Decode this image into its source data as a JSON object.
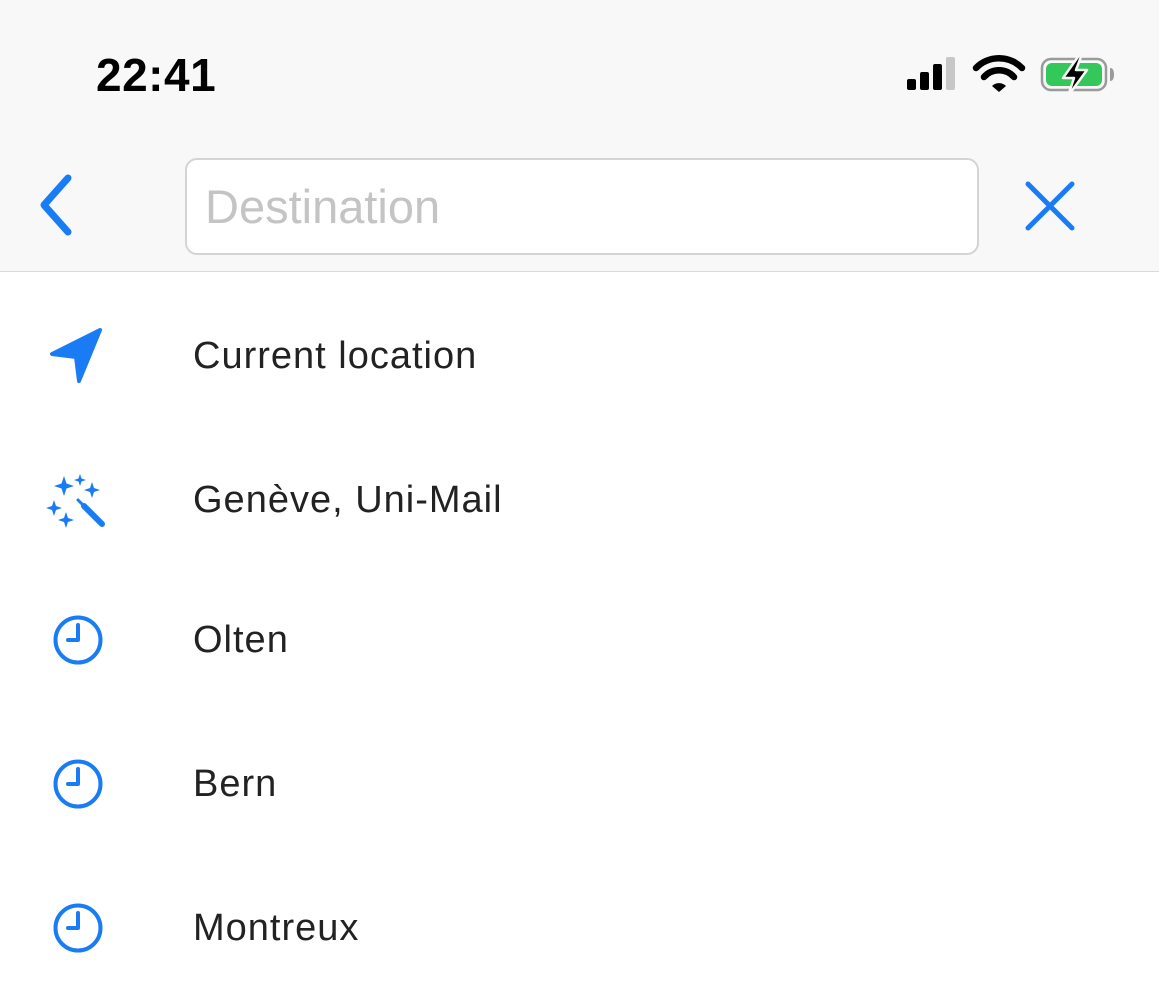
{
  "status_bar": {
    "time": "22:41",
    "icons": [
      "cellular-signal-icon",
      "wifi-icon",
      "battery-charging-icon"
    ]
  },
  "nav": {
    "back_icon": "chevron-left-icon",
    "search_placeholder": "Destination",
    "search_value": "",
    "clear_icon": "close-icon"
  },
  "colors": {
    "accent": "#1a7cf5",
    "battery_fill": "#34c759",
    "text": "#222222",
    "placeholder": "#c4c4c4"
  },
  "list": {
    "items": [
      {
        "label": "Current location",
        "icon": "location-arrow-icon"
      },
      {
        "label": "Genève, Uni-Mail",
        "icon": "magic-wand-icon"
      },
      {
        "label": "Olten",
        "icon": "clock-icon"
      },
      {
        "label": "Bern",
        "icon": "clock-icon"
      },
      {
        "label": "Montreux",
        "icon": "clock-icon"
      }
    ]
  }
}
